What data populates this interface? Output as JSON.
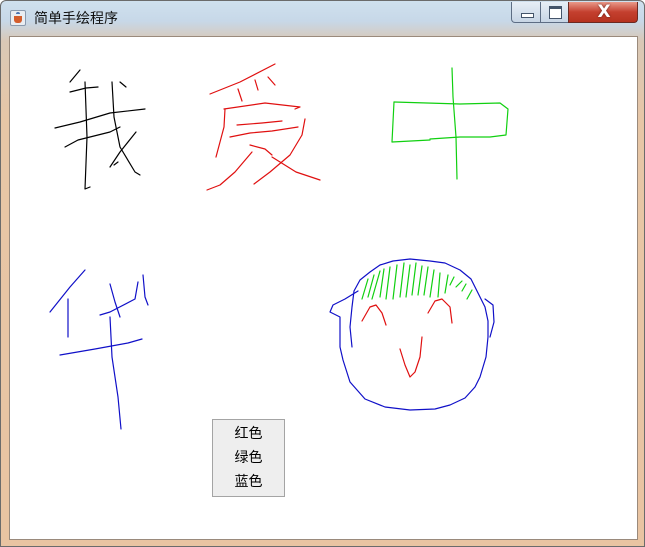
{
  "window": {
    "title": "简单手绘程序",
    "app_icon": "java-cup-icon",
    "caption_buttons": {
      "minimize": "minimize-icon",
      "maximize": "maximize-icon",
      "close_glyph": "X"
    }
  },
  "canvas": {
    "background": "#ffffff",
    "stroke_colors": {
      "black": "#000000",
      "red": "#e01010",
      "green": "#10d010",
      "blue": "#1010c8"
    }
  },
  "context_menu": {
    "items": [
      {
        "label": "红色",
        "color": "#ff0000"
      },
      {
        "label": "绿色",
        "color": "#00ff00"
      },
      {
        "label": "蓝色",
        "color": "#0000ff"
      }
    ]
  }
}
